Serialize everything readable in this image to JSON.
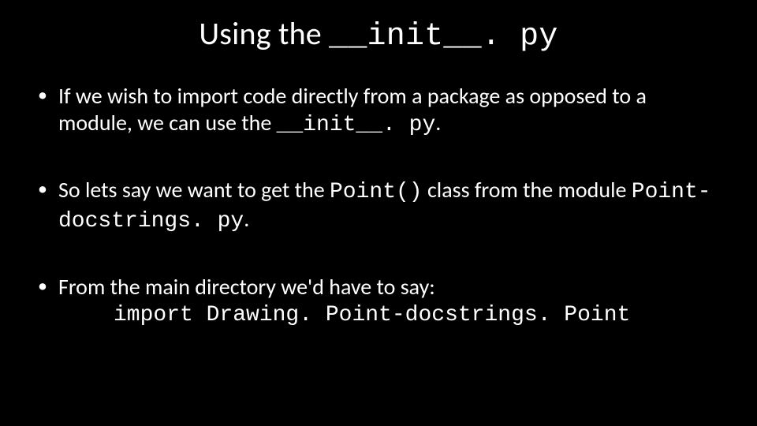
{
  "title": {
    "prefix": "Using the ",
    "code": "__init__. py"
  },
  "bullets": [
    {
      "parts": [
        {
          "t": "If we wish to import code directly from a package as opposed to a module, we can use the "
        },
        {
          "t": "__init__. py",
          "code": true
        },
        {
          "t": "."
        }
      ]
    },
    {
      "parts": [
        {
          "t": "So lets say we want to get the "
        },
        {
          "t": "Point()",
          "code": true
        },
        {
          "t": " class from the module "
        },
        {
          "t": "Point-docstrings. py",
          "code": true
        },
        {
          "t": "."
        }
      ]
    },
    {
      "parts": [
        {
          "t": "From the main directory we'd have to say:"
        }
      ],
      "code_line": "import Drawing. Point-docstrings. Point"
    }
  ]
}
